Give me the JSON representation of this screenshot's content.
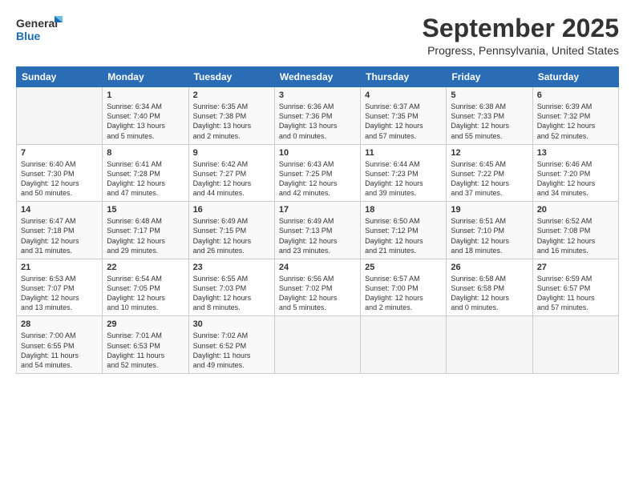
{
  "header": {
    "logo_line1": "General",
    "logo_line2": "Blue",
    "month": "September 2025",
    "location": "Progress, Pennsylvania, United States"
  },
  "weekdays": [
    "Sunday",
    "Monday",
    "Tuesday",
    "Wednesday",
    "Thursday",
    "Friday",
    "Saturday"
  ],
  "weeks": [
    [
      {
        "day": "",
        "info": ""
      },
      {
        "day": "1",
        "info": "Sunrise: 6:34 AM\nSunset: 7:40 PM\nDaylight: 13 hours\nand 5 minutes."
      },
      {
        "day": "2",
        "info": "Sunrise: 6:35 AM\nSunset: 7:38 PM\nDaylight: 13 hours\nand 2 minutes."
      },
      {
        "day": "3",
        "info": "Sunrise: 6:36 AM\nSunset: 7:36 PM\nDaylight: 13 hours\nand 0 minutes."
      },
      {
        "day": "4",
        "info": "Sunrise: 6:37 AM\nSunset: 7:35 PM\nDaylight: 12 hours\nand 57 minutes."
      },
      {
        "day": "5",
        "info": "Sunrise: 6:38 AM\nSunset: 7:33 PM\nDaylight: 12 hours\nand 55 minutes."
      },
      {
        "day": "6",
        "info": "Sunrise: 6:39 AM\nSunset: 7:32 PM\nDaylight: 12 hours\nand 52 minutes."
      }
    ],
    [
      {
        "day": "7",
        "info": "Sunrise: 6:40 AM\nSunset: 7:30 PM\nDaylight: 12 hours\nand 50 minutes."
      },
      {
        "day": "8",
        "info": "Sunrise: 6:41 AM\nSunset: 7:28 PM\nDaylight: 12 hours\nand 47 minutes."
      },
      {
        "day": "9",
        "info": "Sunrise: 6:42 AM\nSunset: 7:27 PM\nDaylight: 12 hours\nand 44 minutes."
      },
      {
        "day": "10",
        "info": "Sunrise: 6:43 AM\nSunset: 7:25 PM\nDaylight: 12 hours\nand 42 minutes."
      },
      {
        "day": "11",
        "info": "Sunrise: 6:44 AM\nSunset: 7:23 PM\nDaylight: 12 hours\nand 39 minutes."
      },
      {
        "day": "12",
        "info": "Sunrise: 6:45 AM\nSunset: 7:22 PM\nDaylight: 12 hours\nand 37 minutes."
      },
      {
        "day": "13",
        "info": "Sunrise: 6:46 AM\nSunset: 7:20 PM\nDaylight: 12 hours\nand 34 minutes."
      }
    ],
    [
      {
        "day": "14",
        "info": "Sunrise: 6:47 AM\nSunset: 7:18 PM\nDaylight: 12 hours\nand 31 minutes."
      },
      {
        "day": "15",
        "info": "Sunrise: 6:48 AM\nSunset: 7:17 PM\nDaylight: 12 hours\nand 29 minutes."
      },
      {
        "day": "16",
        "info": "Sunrise: 6:49 AM\nSunset: 7:15 PM\nDaylight: 12 hours\nand 26 minutes."
      },
      {
        "day": "17",
        "info": "Sunrise: 6:49 AM\nSunset: 7:13 PM\nDaylight: 12 hours\nand 23 minutes."
      },
      {
        "day": "18",
        "info": "Sunrise: 6:50 AM\nSunset: 7:12 PM\nDaylight: 12 hours\nand 21 minutes."
      },
      {
        "day": "19",
        "info": "Sunrise: 6:51 AM\nSunset: 7:10 PM\nDaylight: 12 hours\nand 18 minutes."
      },
      {
        "day": "20",
        "info": "Sunrise: 6:52 AM\nSunset: 7:08 PM\nDaylight: 12 hours\nand 16 minutes."
      }
    ],
    [
      {
        "day": "21",
        "info": "Sunrise: 6:53 AM\nSunset: 7:07 PM\nDaylight: 12 hours\nand 13 minutes."
      },
      {
        "day": "22",
        "info": "Sunrise: 6:54 AM\nSunset: 7:05 PM\nDaylight: 12 hours\nand 10 minutes."
      },
      {
        "day": "23",
        "info": "Sunrise: 6:55 AM\nSunset: 7:03 PM\nDaylight: 12 hours\nand 8 minutes."
      },
      {
        "day": "24",
        "info": "Sunrise: 6:56 AM\nSunset: 7:02 PM\nDaylight: 12 hours\nand 5 minutes."
      },
      {
        "day": "25",
        "info": "Sunrise: 6:57 AM\nSunset: 7:00 PM\nDaylight: 12 hours\nand 2 minutes."
      },
      {
        "day": "26",
        "info": "Sunrise: 6:58 AM\nSunset: 6:58 PM\nDaylight: 12 hours\nand 0 minutes."
      },
      {
        "day": "27",
        "info": "Sunrise: 6:59 AM\nSunset: 6:57 PM\nDaylight: 11 hours\nand 57 minutes."
      }
    ],
    [
      {
        "day": "28",
        "info": "Sunrise: 7:00 AM\nSunset: 6:55 PM\nDaylight: 11 hours\nand 54 minutes."
      },
      {
        "day": "29",
        "info": "Sunrise: 7:01 AM\nSunset: 6:53 PM\nDaylight: 11 hours\nand 52 minutes."
      },
      {
        "day": "30",
        "info": "Sunrise: 7:02 AM\nSunset: 6:52 PM\nDaylight: 11 hours\nand 49 minutes."
      },
      {
        "day": "",
        "info": ""
      },
      {
        "day": "",
        "info": ""
      },
      {
        "day": "",
        "info": ""
      },
      {
        "day": "",
        "info": ""
      }
    ]
  ]
}
